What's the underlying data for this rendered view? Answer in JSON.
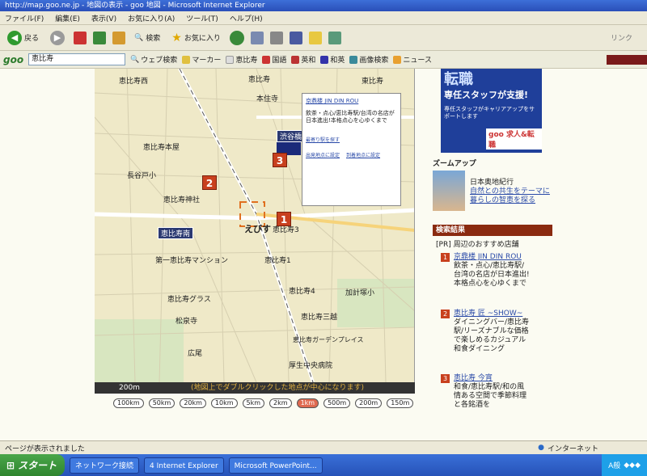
{
  "window": {
    "title": "http://map.goo.ne.jp - 地図の表示 - goo 地図 - Microsoft Internet Explorer"
  },
  "menubar": [
    "ファイル(F)",
    "編集(E)",
    "表示(V)",
    "お気に入り(A)",
    "ツール(T)",
    "ヘルプ(H)"
  ],
  "toolbar": {
    "back": "戻る",
    "search": "検索",
    "favorites": "お気に入り",
    "links": "リンク"
  },
  "goobar": {
    "logo": "goo",
    "query": "恵比寿",
    "web_search": "ウェブ検索",
    "marker": "マーカー",
    "ebisu": "恵比寿",
    "kokugo": "国語",
    "eiwa": "英和",
    "waei": "和英",
    "image_search": "画像検索",
    "news": "ニュース"
  },
  "map": {
    "labels": [
      "恵比寿西",
      "恵比寿",
      "恵比寿南",
      "恵比寿4",
      "恵比寿三越",
      "厚生中央病院",
      "広尾",
      "本住寺",
      "恵比寿神社",
      "長谷戸小",
      "加計塚小",
      "恵比寿ガーデンプレイス",
      "第一恵比寿マンション",
      "恵比寿グラス",
      "松泉寺",
      "渋谷橋",
      "恵比寿3",
      "恵比寿1",
      "東比寿",
      "えびす",
      "恵比寿本屋"
    ],
    "stations": [
      "恵比寿南",
      "渋谷橋"
    ],
    "markers": [
      "1",
      "2",
      "3"
    ],
    "popup": {
      "title": "京鼎楼 JIN DIN ROU",
      "desc": "飲茶・点心/恵比寿駅/台湾の名店が日本進出!本格点心を心ゆくまで",
      "link1": "最寄り駅を探す",
      "link2": "出発地点に設定",
      "link3": "到着地点に設定"
    },
    "note": "(地図上でダブルクリックした地点が中心になります)",
    "scale_label": "200m",
    "scales": [
      "100km",
      "50km",
      "20km",
      "10km",
      "5km",
      "2km",
      "1km",
      "500m",
      "200m",
      "150m"
    ],
    "active_scale": "1km"
  },
  "sidebar": {
    "ad": {
      "big": "転職",
      "sub": "専任スタッフが支援!",
      "small": "専任スタッフがキャリアアップをサポートします",
      "foot": "goo 求人&転職"
    },
    "zoomup_title": "ズームアップ",
    "zoomup_caption": "日本奥地紀行",
    "zoomup_link": "自然との共生をテーマに暮らしの智恵を探る",
    "results_head": "検索結果",
    "pr_line": "[PR] 周辺のおすすめ店舗",
    "results": [
      {
        "num": "1",
        "title": "京鼎楼 JIN DIN ROU",
        "desc": "飲茶・点心/恵比寿駅/台湾の名店が日本進出!本格点心を心ゆくまで"
      },
      {
        "num": "2",
        "title": "恵比寿 匠 ~SHOW~",
        "desc": "ダイニングバー/恵比寿駅/リーズナブルな価格で楽しめるカジュアル和食ダイニング"
      },
      {
        "num": "3",
        "title": "恵比寿 今宵",
        "desc": "和食/恵比寿駅/和の風情ある空間で季節料理と各銘酒を"
      }
    ]
  },
  "status": {
    "text": "ページが表示されました",
    "zone": "インターネット"
  },
  "taskbar": {
    "start": "スタート",
    "tasks": [
      "ネットワーク接続",
      "4 Internet Explorer",
      "Microsoft PowerPoint..."
    ],
    "tray_ime": "A般"
  },
  "colors": {
    "marker": "#c8401e",
    "results_head": "#8a2a10",
    "ad_bg": "#1f3f9a",
    "taskbar": "#2652b8"
  }
}
